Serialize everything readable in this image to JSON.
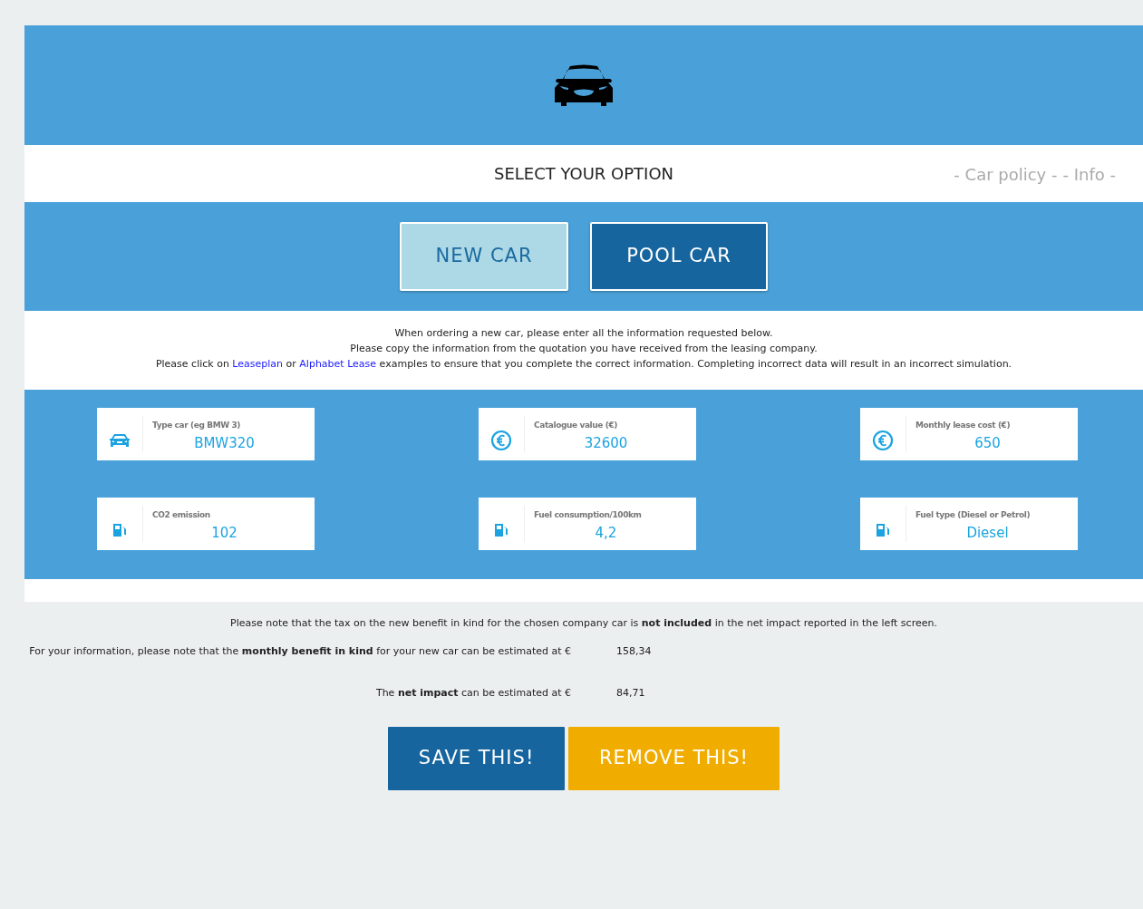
{
  "header": {
    "title": "SELECT YOUR OPTION",
    "links": [
      {
        "label": "- Car policy -"
      },
      {
        "label": "- Info -"
      }
    ]
  },
  "options": [
    {
      "label": "NEW CAR",
      "selected": true
    },
    {
      "label": "POOL CAR",
      "selected": false
    }
  ],
  "intro": [
    {
      "kind": "text",
      "parts": [
        {
          "text": "When ordering a new car, please enter all the information requested below."
        }
      ]
    },
    {
      "kind": "text",
      "parts": [
        {
          "text": "Please copy the information from the quotation you have received from the leasing company."
        }
      ]
    },
    {
      "kind": "text",
      "parts": [
        {
          "text": "Please click on "
        },
        {
          "link": "Leaseplan"
        },
        {
          "text": " or "
        },
        {
          "link": "Alphabet Lease"
        },
        {
          "text": " examples to ensure that you complete the correct information. Completing incorrect data will result in an incorrect simulation."
        }
      ]
    }
  ],
  "fields": [
    {
      "kind": "car",
      "label": "Type car (eg BMW 3)",
      "value": "BMW320"
    },
    {
      "kind": "euro",
      "label": "Catalogue value (€)",
      "value": "32600"
    },
    {
      "kind": "euro",
      "label": "Monthly lease cost (€)",
      "value": "650"
    },
    {
      "kind": "fuel",
      "label": "CO2 emission",
      "value": "102"
    },
    {
      "kind": "fuel",
      "label": "Fuel consumption/100km",
      "value": "4,2"
    },
    {
      "kind": "fuel",
      "label": "Fuel type (Diesel or Petrol)",
      "value": "Diesel"
    }
  ],
  "note": "Please note that the tax on the new benefit in kind for the chosen company car is **not included** in the net impact reported in the left screen.",
  "estimates": [
    {
      "label": "For your information, please note that the **monthly benefit in kind** for your new car can be estimated at €",
      "value": "158,34"
    },
    {
      "label": "The **net impact** can be estimated at €",
      "value": "84,71"
    }
  ],
  "actions": [
    {
      "kind": "save",
      "label": "SAVE THIS!"
    },
    {
      "kind": "remove",
      "label": "REMOVE THIS!"
    }
  ]
}
